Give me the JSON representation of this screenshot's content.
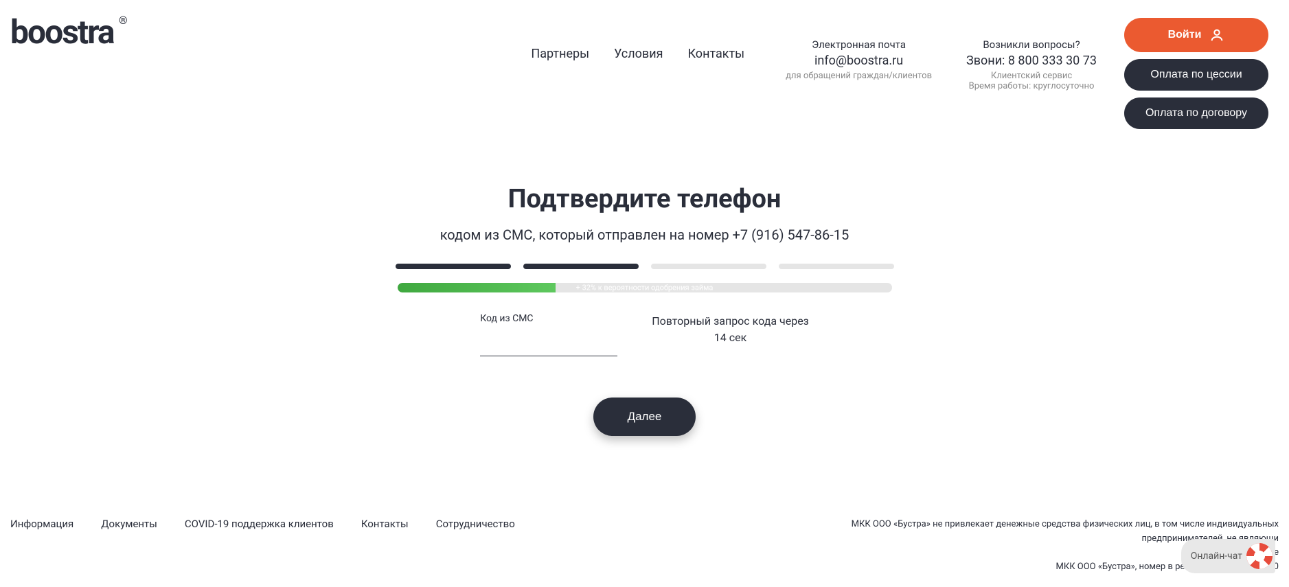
{
  "header": {
    "logo": "boostra",
    "nav": [
      "Партнеры",
      "Условия",
      "Контакты"
    ],
    "email_label": "Электронная почта",
    "email_value": "info@boostra.ru",
    "email_sub": "для обращений граждан/клиентов",
    "phone_label": "Возникли вопросы?",
    "phone_value": "Звони: 8 800 333 30 73",
    "phone_sub1": "Клиентский сервис",
    "phone_sub2": "Время работы: круглосуточно",
    "buttons": {
      "login": "Войти",
      "cession": "Оплата по цессии",
      "contract": "Оплата по договору"
    }
  },
  "main": {
    "title": "Подтвердите телефон",
    "subtitle": "кодом из СМС, который отправлен на номер +7 (916) 547-86-15",
    "approval_text": "+ 32% к вероятности одобрения займа",
    "approval_percent": 32,
    "steps_total": 4,
    "steps_done": 2,
    "sms_label": "Код из СМС",
    "sms_value": "",
    "resend_line1": "Повторный запрос кода через",
    "resend_line2": "14 сек",
    "submit": "Далее"
  },
  "footer": {
    "links": [
      "Информация",
      "Документы",
      "COVID-19 поддержка клиентов",
      "Контакты",
      "Сотрудничество"
    ],
    "text1": "МКК ООО «Бустра» не привлекает денежные средства физических лиц, в том числе индивидуальных предпринимателей, не являющи",
    "text2": "учре",
    "text3": "МКК ООО «Бустра», номер в реестре МФО 170333360"
  },
  "chat": {
    "label": "Онлайн-чат"
  }
}
